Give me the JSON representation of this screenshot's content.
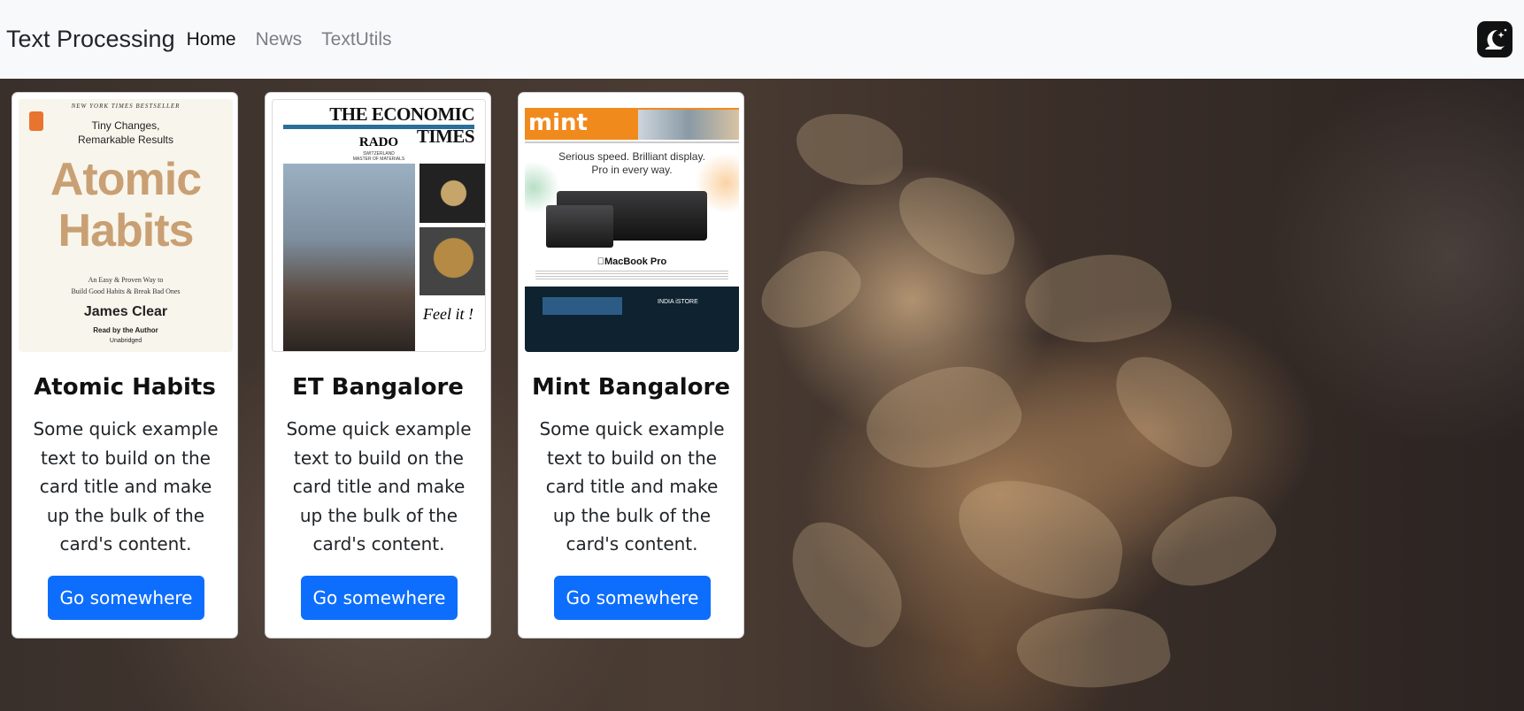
{
  "navbar": {
    "brand": "Text Processing",
    "links": [
      {
        "label": "Home",
        "active": true
      },
      {
        "label": "News",
        "active": false
      },
      {
        "label": "TextUtils",
        "active": false
      }
    ],
    "mode_toggle_icon": "moon-stars-icon"
  },
  "colors": {
    "navbar_bg": "#f8f9fa",
    "button_bg": "#0d6efd",
    "button_text": "#ffffff"
  },
  "cards": [
    {
      "title": "Atomic Habits",
      "text": "Some quick example text to build on the card title and make up the bulk of the card's content.",
      "button": "Go somewhere",
      "cover": {
        "kicker": "NEW YORK TIMES BESTSELLER",
        "tagline_1": "Tiny Changes,",
        "tagline_2": "Remarkable Results",
        "title_1": "Atomic",
        "title_2": "Habits",
        "subtitle_1": "An Easy & Proven Way to",
        "subtitle_2": "Build Good Habits & Break Bad Ones",
        "author": "James Clear",
        "narrator": "Read by the Author",
        "edition": "Unabridged"
      }
    },
    {
      "title": "ET Bangalore",
      "text": "Some quick example text to build on the card title and make up the bulk of the card's content.",
      "button": "Go somewhere",
      "cover": {
        "masthead": "THE ECONOMIC TIMES",
        "ad_brand": "RADO",
        "ad_sub": "SWITZERLAND",
        "ad_line": "MASTER OF MATERIALS",
        "signature": "Feel it !"
      }
    },
    {
      "title": "Mint Bangalore",
      "text": "Some quick example text to build on the card title and make up the bulk of the card's content.",
      "button": "Go somewhere",
      "cover": {
        "logo": "mint",
        "headline_1": "Serious speed. Brilliant display.",
        "headline_2": "Pro in every way.",
        "product": "MacBook Pro",
        "partner": "INDIA iSTORE"
      }
    }
  ]
}
